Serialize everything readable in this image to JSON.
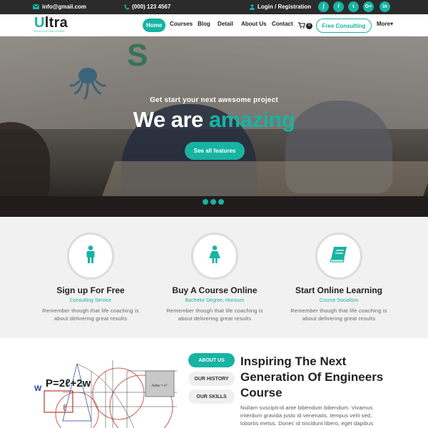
{
  "topbar": {
    "email": "info@gmail.com",
    "phone": "(000) 123 4567",
    "login": "Login / Registration",
    "social": [
      "rss-icon",
      "facebook-icon",
      "twitter-icon",
      "google-plus-icon",
      "linkedin-icon"
    ],
    "social_labels": {
      "rss": "ʃ",
      "facebook": "f",
      "twitter": "t",
      "gplus": "G+",
      "linkedin": "in"
    }
  },
  "brand": {
    "logo_u": "U",
    "logo_rest": "ltra",
    "tagline": "EDUCATION ZONE"
  },
  "nav": {
    "home": "Home",
    "courses": "Courses",
    "blog": "Blog",
    "detail": "Detail",
    "about": "About Us",
    "contact": "Contact",
    "cart_count": "0",
    "consult_button": "Free Consulting",
    "more": "More"
  },
  "hero": {
    "subtitle": "Get start your next awesome project",
    "title_plain": "We are ",
    "title_accent": "amazing",
    "button": "See all features",
    "slides": 3
  },
  "features": [
    {
      "title": "Sign up For Free",
      "subtitle": "Consulting Service",
      "text": "Remember though that life coaching is about delivering great results",
      "icon": "person-icon"
    },
    {
      "title": "Buy A Course Online",
      "subtitle": "Bachelor Degree, Honours",
      "text": "Remember though that life coaching is about delivering great results",
      "icon": "person-dress-icon"
    },
    {
      "title": "Start Online Learning",
      "subtitle": "Course Socialism",
      "text": "Remember though that life coaching is about delivering great results",
      "icon": "book-icon"
    }
  ],
  "about": {
    "tabs": [
      "ABOUT US",
      "OUR HISTORY",
      "OUR SKILLS"
    ],
    "title": "Inspiring The Next Generation Of Engineers Course",
    "text": "Nullam suscipit id ante bibendum bibendum. Vivamus interdum gravida justo id venenatis. tempus velit sed, lobortis metus. Donec id tincidunt libero, eget dapibus",
    "image_formula": "P=2ℓ+2w",
    "image_w": "W",
    "image_l": "ℓ",
    "image_area": "Area = r²"
  },
  "colors": {
    "accent": "#17b3a3",
    "topbar": "#2b2b2b",
    "features_bg": "#f1f1f1"
  }
}
